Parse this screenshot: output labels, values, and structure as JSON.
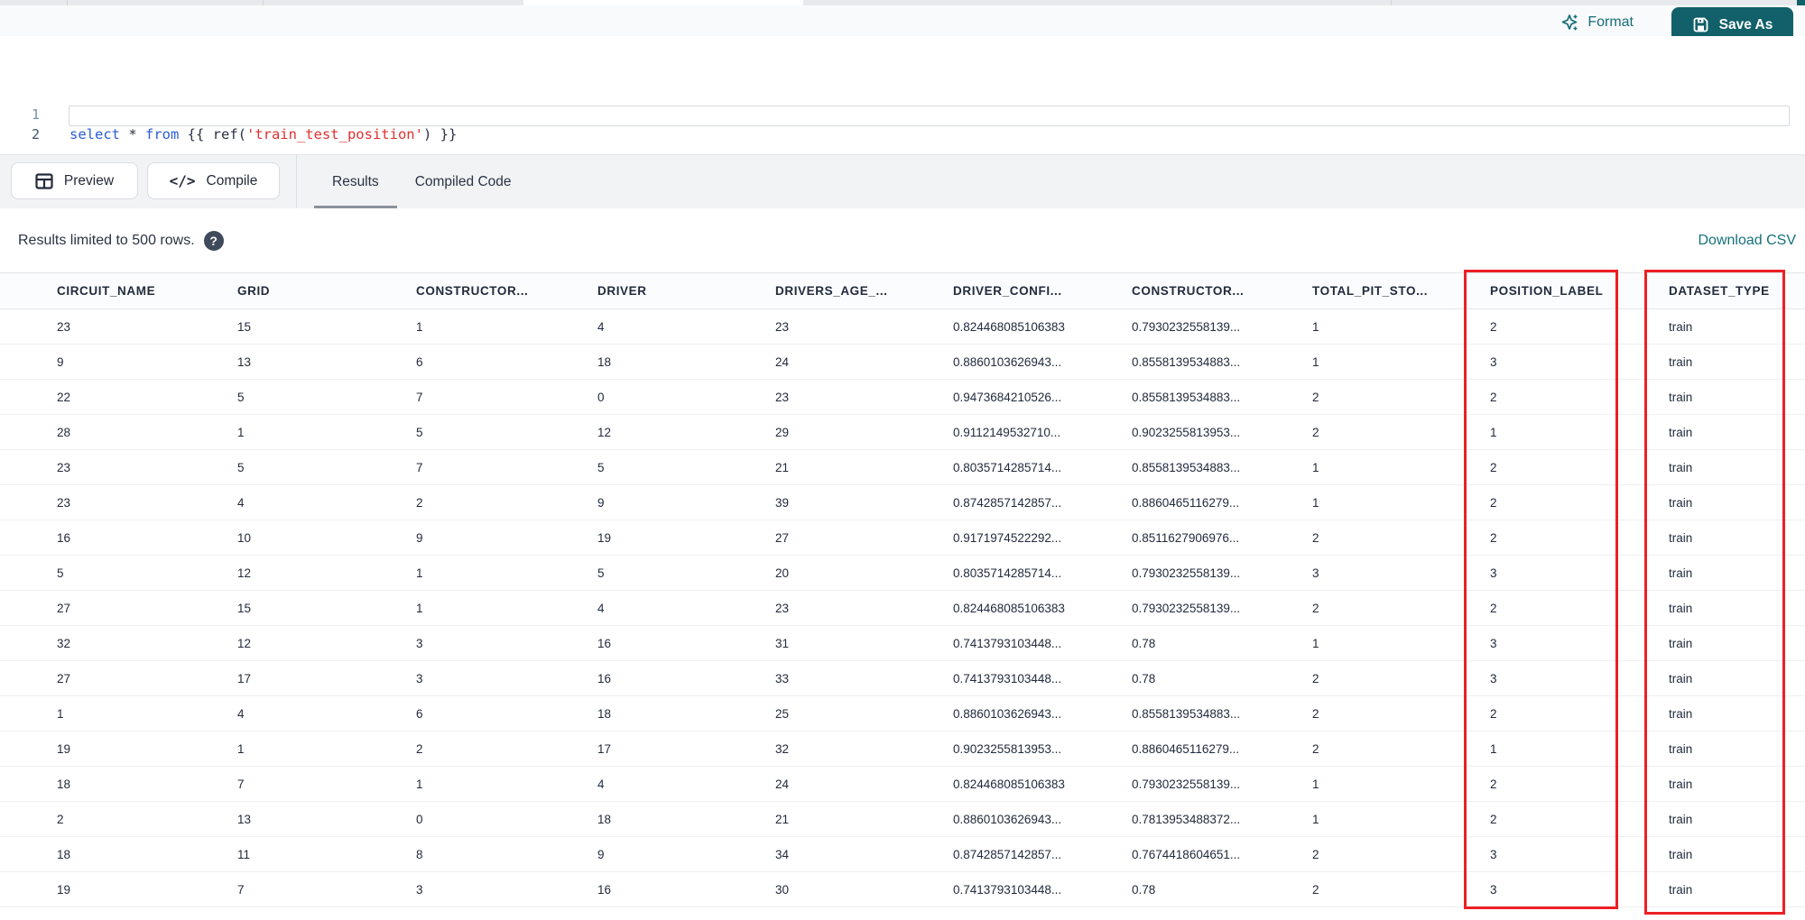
{
  "toolbar": {
    "format_label": "Format",
    "save_as_label": "Save As"
  },
  "code": {
    "line1_number": "1",
    "line2_number": "2",
    "t_select": "select",
    "t_star": " * ",
    "t_from": "from",
    "t_open": " {{ ",
    "t_ref": "ref(",
    "t_str": "'train_test_position'",
    "t_close": ") }}"
  },
  "actions": {
    "preview_label": "Preview",
    "compile_label": "Compile"
  },
  "tabs": {
    "results": "Results",
    "compiled_code": "Compiled Code"
  },
  "results_bar": {
    "limit_text": "Results limited to 500 rows.",
    "help_glyph": "?",
    "download_csv": "Download CSV"
  },
  "table": {
    "columns": [
      "CIRCUIT_NAME",
      "GRID",
      "CONSTRUCTOR...",
      "DRIVER",
      "DRIVERS_AGE_...",
      "DRIVER_CONFI...",
      "CONSTRUCTOR...",
      "TOTAL_PIT_STO...",
      "POSITION_LABEL",
      "DATASET_TYPE"
    ],
    "rows": [
      [
        "23",
        "15",
        "1",
        "4",
        "23",
        "0.824468085106383",
        "0.7930232558139...",
        "1",
        "2",
        "train"
      ],
      [
        "9",
        "13",
        "6",
        "18",
        "24",
        "0.8860103626943...",
        "0.8558139534883...",
        "1",
        "3",
        "train"
      ],
      [
        "22",
        "5",
        "7",
        "0",
        "23",
        "0.9473684210526...",
        "0.8558139534883...",
        "2",
        "2",
        "train"
      ],
      [
        "28",
        "1",
        "5",
        "12",
        "29",
        "0.9112149532710...",
        "0.9023255813953...",
        "2",
        "1",
        "train"
      ],
      [
        "23",
        "5",
        "7",
        "5",
        "21",
        "0.8035714285714...",
        "0.8558139534883...",
        "1",
        "2",
        "train"
      ],
      [
        "23",
        "4",
        "2",
        "9",
        "39",
        "0.8742857142857...",
        "0.8860465116279...",
        "1",
        "2",
        "train"
      ],
      [
        "16",
        "10",
        "9",
        "19",
        "27",
        "0.9171974522292...",
        "0.8511627906976...",
        "2",
        "2",
        "train"
      ],
      [
        "5",
        "12",
        "1",
        "5",
        "20",
        "0.8035714285714...",
        "0.7930232558139...",
        "3",
        "3",
        "train"
      ],
      [
        "27",
        "15",
        "1",
        "4",
        "23",
        "0.824468085106383",
        "0.7930232558139...",
        "2",
        "2",
        "train"
      ],
      [
        "32",
        "12",
        "3",
        "16",
        "31",
        "0.7413793103448...",
        "0.78",
        "1",
        "3",
        "train"
      ],
      [
        "27",
        "17",
        "3",
        "16",
        "33",
        "0.7413793103448...",
        "0.78",
        "2",
        "3",
        "train"
      ],
      [
        "1",
        "4",
        "6",
        "18",
        "25",
        "0.8860103626943...",
        "0.8558139534883...",
        "2",
        "2",
        "train"
      ],
      [
        "19",
        "1",
        "2",
        "17",
        "32",
        "0.9023255813953...",
        "0.8860465116279...",
        "2",
        "1",
        "train"
      ],
      [
        "18",
        "7",
        "1",
        "4",
        "24",
        "0.824468085106383",
        "0.7930232558139...",
        "1",
        "2",
        "train"
      ],
      [
        "2",
        "13",
        "0",
        "18",
        "21",
        "0.8860103626943...",
        "0.7813953488372...",
        "1",
        "2",
        "train"
      ],
      [
        "18",
        "11",
        "8",
        "9",
        "34",
        "0.8742857142857...",
        "0.7674418604651...",
        "2",
        "3",
        "train"
      ],
      [
        "19",
        "7",
        "3",
        "16",
        "30",
        "0.7413793103448...",
        "0.78",
        "2",
        "3",
        "train"
      ]
    ],
    "highlighted_columns": [
      "POSITION_LABEL",
      "DATASET_TYPE"
    ]
  },
  "colors": {
    "accent_teal": "#11606a",
    "format_teal": "#156e78",
    "link_teal": "#17707c",
    "annotation_red": "#ec2025",
    "keyword_blue": "#2b5cd9",
    "string_red": "#e03131"
  }
}
